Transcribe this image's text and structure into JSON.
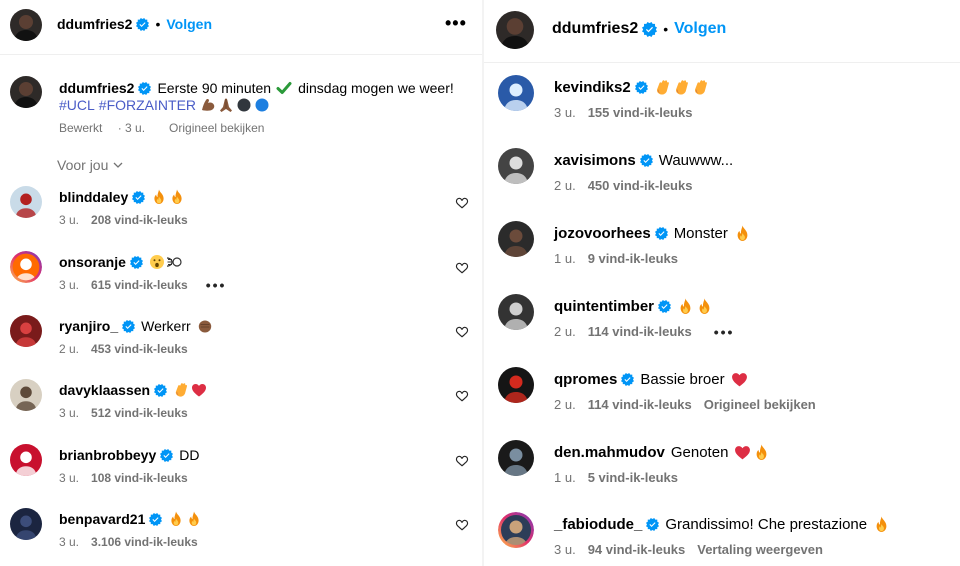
{
  "left": {
    "header": {
      "username": "ddumfries2",
      "follow": "Volgen"
    },
    "caption": {
      "username": "ddumfries2",
      "text": "Eerste 90 minuten",
      "text_after": "dinsdag mogen we weer!",
      "hashtag1": "#UCL",
      "hashtag2": "#FORZAINTER",
      "edited": "Bewerkt",
      "time": "3 u.",
      "original": "Origineel bekijken"
    },
    "for_you": "Voor jou",
    "comments": [
      {
        "username": "blinddaley",
        "text": "",
        "time": "3 u.",
        "likes": "208 vind-ik-leuks",
        "emoji": "fire2"
      },
      {
        "username": "onsoranje",
        "text": "",
        "time": "3 u.",
        "likes": "615 vind-ik-leuks",
        "emoji": "wow-dash"
      },
      {
        "username": "ryanjiro_",
        "text": "Werkerr",
        "time": "2 u.",
        "likes": "453 vind-ik-leuks",
        "emoji": "fist"
      },
      {
        "username": "davyklaassen",
        "text": "",
        "time": "3 u.",
        "likes": "512 vind-ik-leuks",
        "emoji": "clap-heart"
      },
      {
        "username": "brianbrobbeyy",
        "text": "DD",
        "time": "3 u.",
        "likes": "108 vind-ik-leuks",
        "emoji": ""
      },
      {
        "username": "benpavard21",
        "text": "",
        "time": "3 u.",
        "likes": "3.106 vind-ik-leuks",
        "emoji": "fire2"
      }
    ]
  },
  "right": {
    "header": {
      "username": "ddumfries2",
      "follow": "Volgen"
    },
    "comments": [
      {
        "username": "kevindiks2",
        "text": "",
        "time": "3 u.",
        "likes": "155 vind-ik-leuks",
        "extra": "",
        "emoji": "clap3"
      },
      {
        "username": "xavisimons",
        "text": "Wauwww...",
        "time": "2 u.",
        "likes": "450 vind-ik-leuks",
        "extra": "",
        "emoji": ""
      },
      {
        "username": "jozovoorhees",
        "text": "Monster",
        "time": "1 u.",
        "likes": "9 vind-ik-leuks",
        "extra": "",
        "emoji": "fire1"
      },
      {
        "username": "quintentimber",
        "text": "",
        "time": "2 u.",
        "likes": "114 vind-ik-leuks",
        "extra": "",
        "emoji": "fire2"
      },
      {
        "username": "qpromes",
        "text": "Bassie broer",
        "time": "2 u.",
        "likes": "114 vind-ik-leuks",
        "extra": "Origineel bekijken",
        "emoji": "heart"
      },
      {
        "username": "den.mahmudov",
        "text": "Genoten",
        "time": "1 u.",
        "likes": "5 vind-ik-leuks",
        "extra": "",
        "emoji": "heart-fire"
      },
      {
        "username": "_fabiodude_",
        "text": "Grandissimo! Che prestazione",
        "time": "3 u.",
        "likes": "94 vind-ik-leuks",
        "extra": "Vertaling weergeven",
        "emoji": "fire1"
      }
    ]
  },
  "colors": {
    "accent": "#0095f6",
    "hashtag": "#4a5cc7",
    "secondary": "#737373",
    "verified": "#0095f6"
  },
  "icons": [
    "verified-badge-icon",
    "more-options-icon",
    "heart-icon",
    "chevron-down-icon",
    "check-mark-emoji",
    "fire-emoji",
    "clap-emoji",
    "red-heart-emoji",
    "flexed-bicep-emoji",
    "praying-hands-emoji"
  ]
}
